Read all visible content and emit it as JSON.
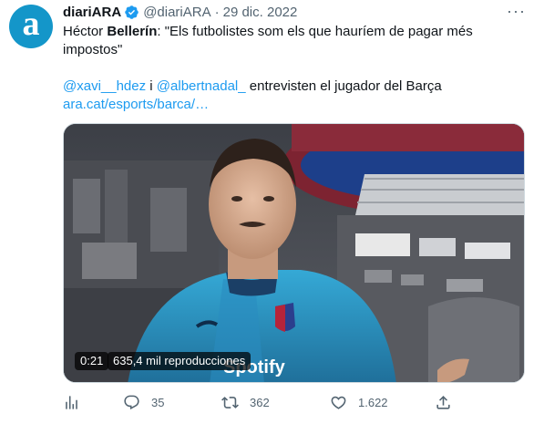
{
  "tweet": {
    "author_name": "diariARA",
    "handle": "@diariARA",
    "separator": "·",
    "date": "29 dic. 2022",
    "more": "···",
    "avatar_letter": "a",
    "text": {
      "prefix": "Héctor ",
      "bold": "Bellerín",
      "quote_line1": ": \"Els futbolistes som els que hauríem de pagar més",
      "quote_line2": "impostos\"",
      "mention1": "@xavi__hdez",
      "connector": " i ",
      "mention2": "@albertnadal_",
      "mention_tail": " entrevisten el jugador del Barça",
      "url": "ara.cat/esports/barca/…"
    },
    "video": {
      "time": "0:21",
      "views": "635,4 mil reproducciones",
      "sponsor_text": "Spotify"
    },
    "actions": {
      "replies": "35",
      "retweets": "362",
      "likes": "1.622"
    }
  },
  "colors": {
    "link": "#1d9bf0",
    "avatar": "#1496c9",
    "muted": "#536471"
  },
  "icons": [
    "verified-icon",
    "more-icon",
    "analytics-icon",
    "reply-icon",
    "retweet-icon",
    "like-icon",
    "share-icon"
  ]
}
